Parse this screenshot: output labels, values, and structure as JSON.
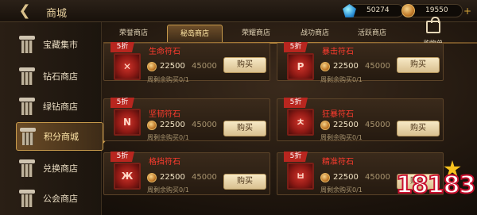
{
  "header": {
    "title": "商城",
    "currencies": [
      {
        "icon": "gem-icon",
        "value": "50274"
      },
      {
        "icon": "coin-icon",
        "value": "19550"
      }
    ]
  },
  "sidebar": {
    "items": [
      {
        "label": "宝藏集市",
        "active": false
      },
      {
        "label": "钻石商店",
        "active": false
      },
      {
        "label": "绿钻商店",
        "active": false
      },
      {
        "label": "积分商城",
        "active": true
      },
      {
        "label": "兑换商店",
        "active": false
      },
      {
        "label": "公会商店",
        "active": false
      }
    ]
  },
  "tabs": [
    {
      "label": "荣誉商店",
      "active": false
    },
    {
      "label": "秘岛商店",
      "active": true
    },
    {
      "label": "荣耀商店",
      "active": false
    },
    {
      "label": "战功商店",
      "active": false
    },
    {
      "label": "活跃商店",
      "active": false
    }
  ],
  "cart": {
    "label": "购物单"
  },
  "cards": [
    {
      "discount": "5折",
      "name": "生命符石",
      "rune": "✕",
      "price": "22500",
      "original_price": "45000",
      "limit": "周剩余购买0/1",
      "buy_label": "购买"
    },
    {
      "discount": "5折",
      "name": "暴击符石",
      "rune": "P",
      "price": "22500",
      "original_price": "45000",
      "limit": "周剩余购买0/1",
      "buy_label": "购买"
    },
    {
      "discount": "5折",
      "name": "坚韧符石",
      "rune": "N",
      "price": "22500",
      "original_price": "45000",
      "limit": "周剩余购买0/1",
      "buy_label": "购买"
    },
    {
      "discount": "5折",
      "name": "狂暴符石",
      "rune": "ㅊ",
      "price": "22500",
      "original_price": "45000",
      "limit": "周剩余购买0/1",
      "buy_label": "购买"
    },
    {
      "discount": "5折",
      "name": "格挡符石",
      "rune": "Ж",
      "price": "22500",
      "original_price": "45000",
      "limit": "周剩余购买0/1",
      "buy_label": "购买"
    },
    {
      "discount": "5折",
      "name": "精准符石",
      "rune": "ㅂ",
      "price": "22500",
      "original_price": "45000",
      "limit": "周剩余购买0/1",
      "buy_label": "购买"
    }
  ],
  "watermark": {
    "text": "18183"
  },
  "colors": {
    "accent_gold": "#c89b4c",
    "discount_red": "#b8261f",
    "name_red": "#ff3b2e"
  }
}
